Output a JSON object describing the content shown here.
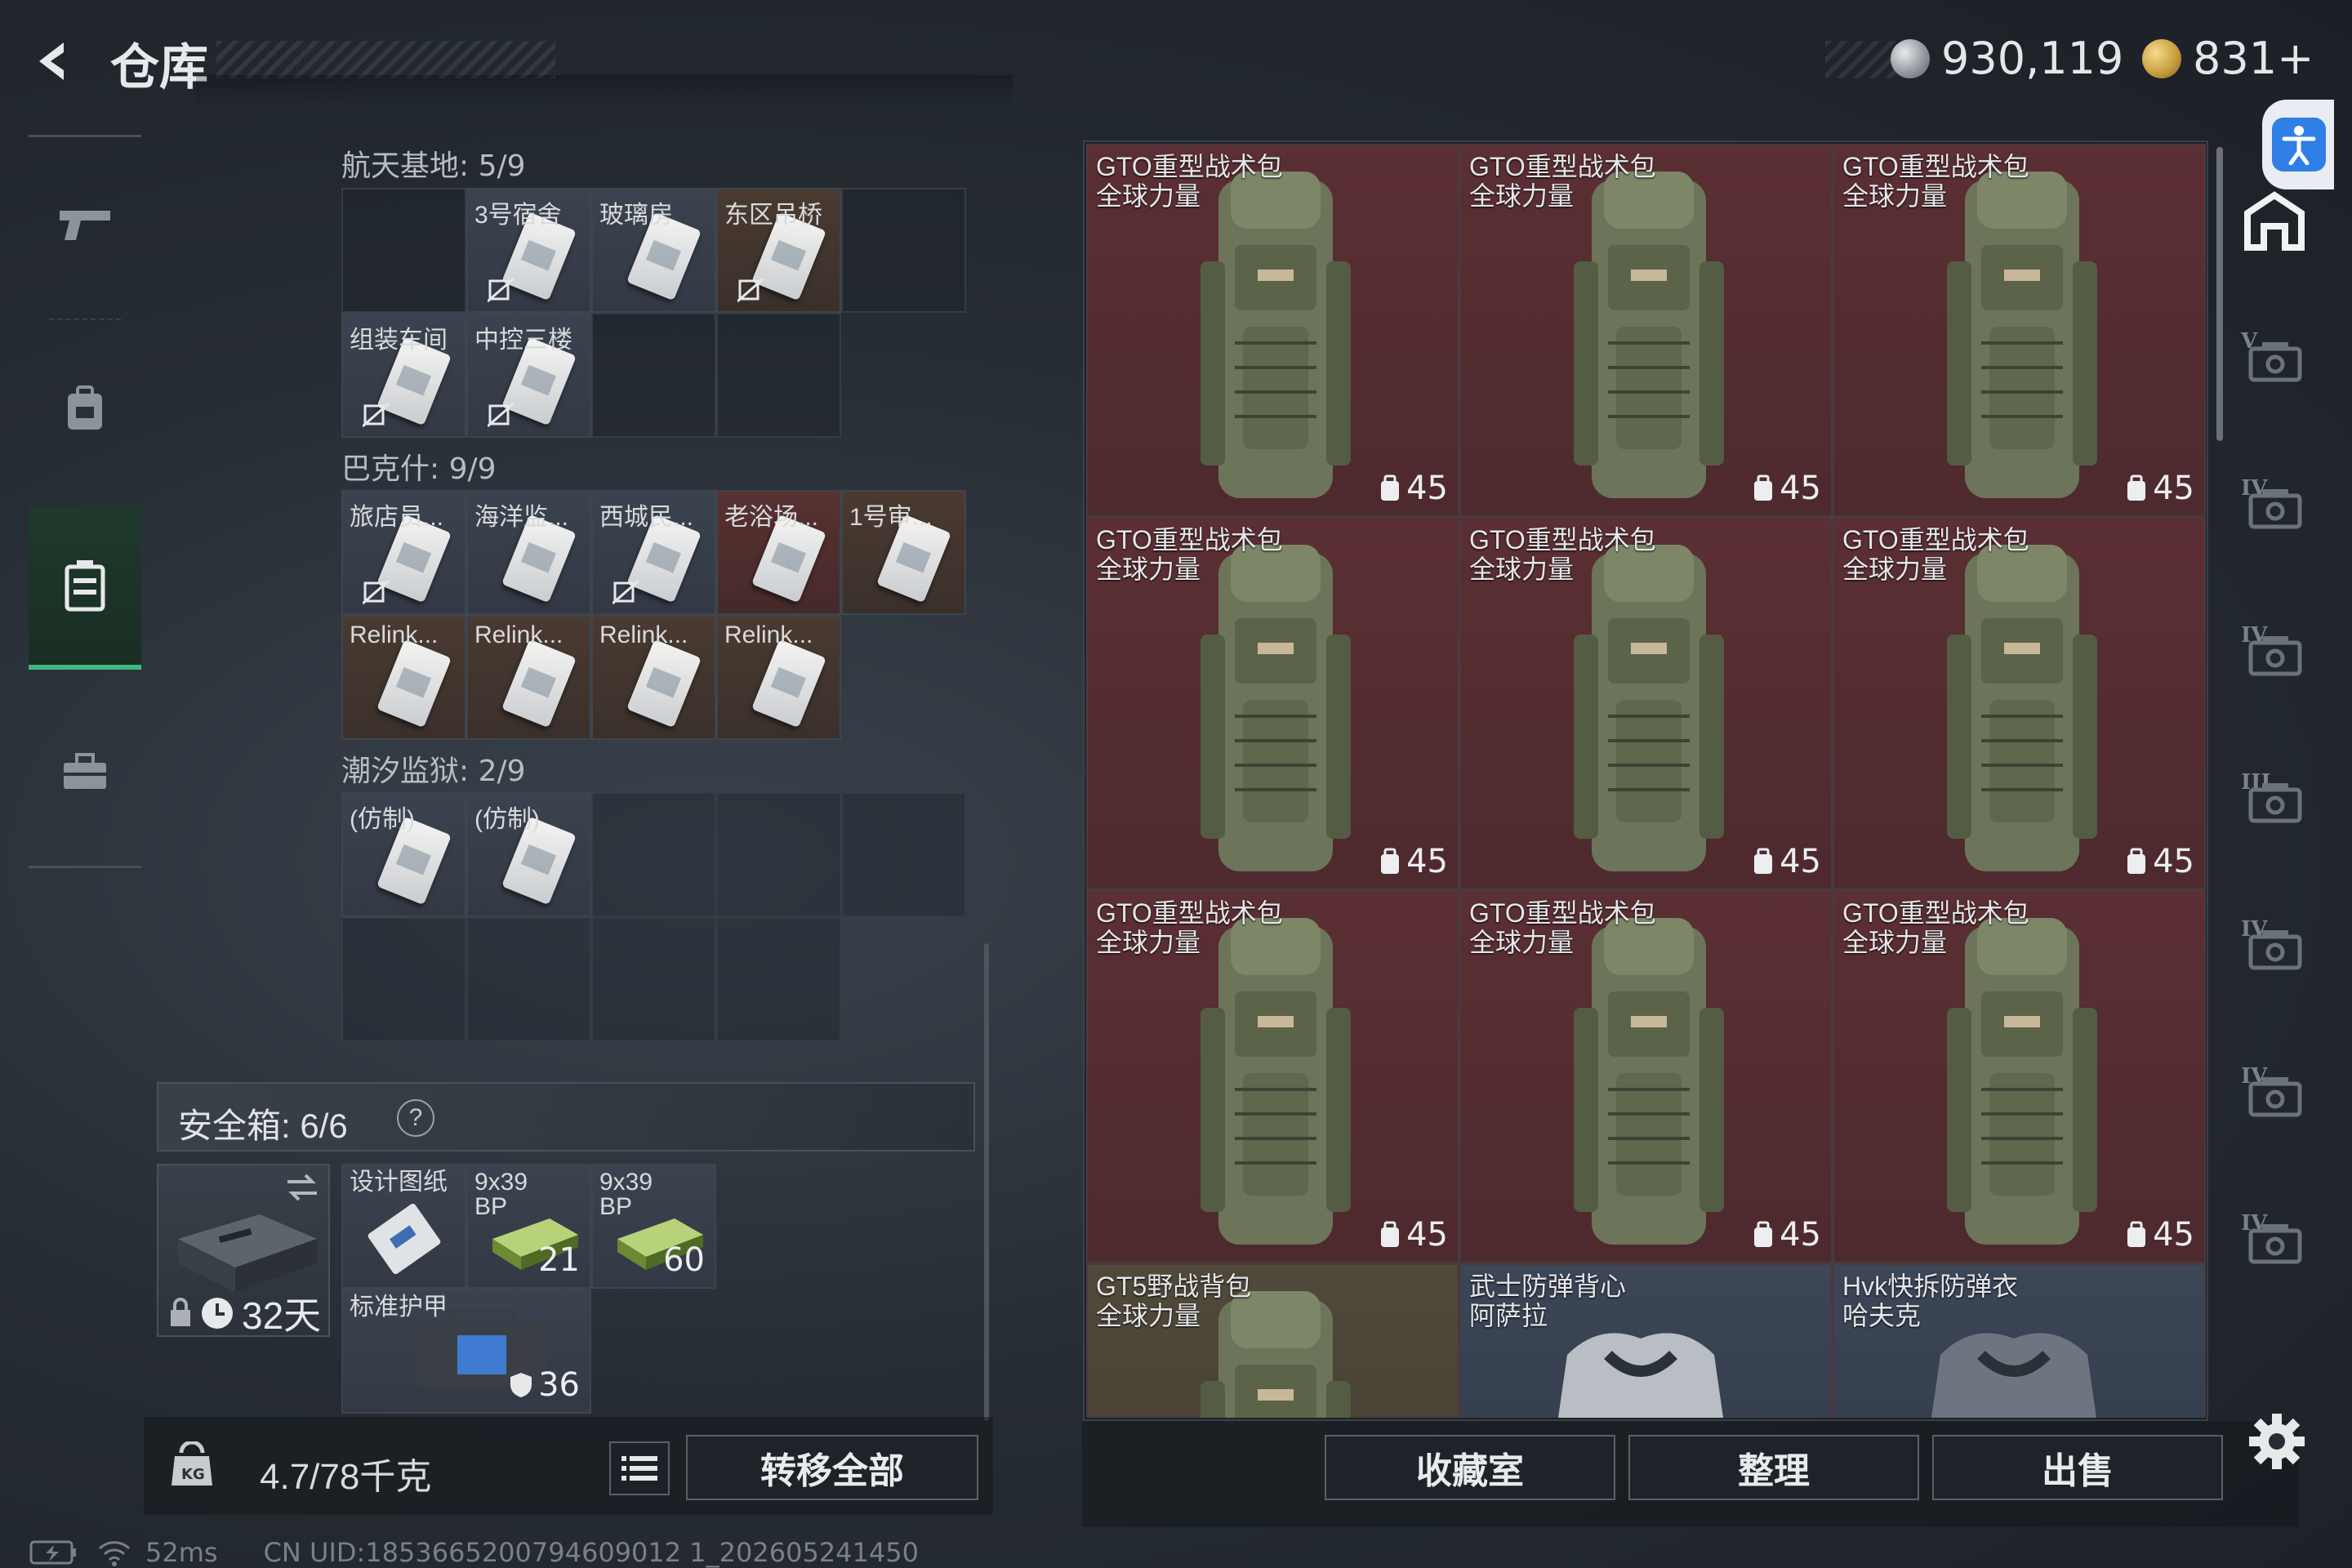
{
  "header": {
    "title": "仓库",
    "currency_silver": "930,119",
    "currency_gold": "831+"
  },
  "groups": [
    {
      "title": "航天基地: 5/9",
      "items": [
        {
          "name": "",
          "style": "empty"
        },
        {
          "name": "3号宿舍",
          "style": "gray",
          "card": true,
          "lock": true
        },
        {
          "name": "玻璃房",
          "style": "gray",
          "card": true
        },
        {
          "name": "东区吊桥",
          "style": "brown",
          "card": true,
          "lock": true
        },
        {
          "name": "",
          "style": "empty"
        },
        {
          "name": "组装车间",
          "style": "gray",
          "card": true,
          "lock": true
        },
        {
          "name": "中控三楼",
          "style": "gray",
          "card": true,
          "lock": true
        },
        {
          "name": "",
          "style": "empty"
        },
        {
          "name": "",
          "style": "empty"
        }
      ]
    },
    {
      "title": "巴克什: 9/9",
      "items": [
        {
          "name": "旅店员...",
          "style": "gray",
          "card": true,
          "lock": true
        },
        {
          "name": "海洋监...",
          "style": "gray",
          "card": true
        },
        {
          "name": "西城民...",
          "style": "gray",
          "card": true,
          "lock": true
        },
        {
          "name": "老浴场...",
          "style": "red",
          "card": true
        },
        {
          "name": "1号审...",
          "style": "brown",
          "card": true
        },
        {
          "name": "Relink...",
          "style": "brown",
          "card": true
        },
        {
          "name": "Relink...",
          "style": "brown",
          "card": true
        },
        {
          "name": "Relink...",
          "style": "brown",
          "card": true
        },
        {
          "name": "Relink...",
          "style": "brown",
          "card": true
        }
      ]
    },
    {
      "title": "潮汐监狱: 2/9",
      "items": [
        {
          "name": "(仿制)",
          "style": "gray",
          "card": true
        },
        {
          "name": "(仿制)",
          "style": "gray",
          "card": true
        },
        {
          "name": "",
          "style": "empty"
        },
        {
          "name": "",
          "style": "empty"
        },
        {
          "name": "",
          "style": "empty"
        },
        {
          "name": "",
          "style": "empty"
        },
        {
          "name": "",
          "style": "empty"
        },
        {
          "name": "",
          "style": "empty"
        },
        {
          "name": "",
          "style": "empty"
        }
      ]
    }
  ],
  "safebox": {
    "label": "安全箱:  6/6",
    "help": "?",
    "days": "32天",
    "items": [
      {
        "name": "设计图纸",
        "count": "",
        "kind": "blueprint"
      },
      {
        "name": "9x39\nBP",
        "count": "21",
        "kind": "ammo"
      },
      {
        "name": "9x39\nBP",
        "count": "60",
        "kind": "ammo"
      },
      {
        "name": "标准护甲",
        "count": "36",
        "kind": "armor"
      }
    ]
  },
  "footer_left": {
    "weight": "4.7/78千克",
    "transfer_label": "转移全部"
  },
  "right_items": [
    {
      "name": "GTO重型战术包\n全球力量",
      "count": "45",
      "style": "red"
    },
    {
      "name": "GTO重型战术包\n全球力量",
      "count": "45",
      "style": "red"
    },
    {
      "name": "GTO重型战术包\n全球力量",
      "count": "45",
      "style": "red"
    },
    {
      "name": "GTO重型战术包\n全球力量",
      "count": "45",
      "style": "red"
    },
    {
      "name": "GTO重型战术包\n全球力量",
      "count": "45",
      "style": "red"
    },
    {
      "name": "GTO重型战术包\n全球力量",
      "count": "45",
      "style": "red"
    },
    {
      "name": "GTO重型战术包\n全球力量",
      "count": "45",
      "style": "red"
    },
    {
      "name": "GTO重型战术包\n全球力量",
      "count": "45",
      "style": "red"
    },
    {
      "name": "GTO重型战术包\n全球力量",
      "count": "45",
      "style": "red"
    },
    {
      "name": "GT5野战背包\n全球力量",
      "count": "",
      "style": "olive"
    },
    {
      "name": "武士防弹背心\n阿萨拉",
      "count": "",
      "style": "blue"
    },
    {
      "name": "Hvk快拆防弹衣\n哈夫克",
      "count": "",
      "style": "blue"
    }
  ],
  "footer_right": {
    "collection": "收藏室",
    "organize": "整理",
    "sell": "出售"
  },
  "side_tier_labels": [
    "V",
    "IV",
    "IV",
    "III",
    "IV",
    "IV",
    "IV"
  ],
  "status_bar": {
    "ping": "52ms",
    "uid": "CN UID:1853665200794609012 1_202605241450"
  },
  "icons": [
    "back-arrow-icon",
    "silver-coin-icon",
    "gold-coin-icon",
    "pistol-icon",
    "backpack-icon",
    "safe-case-icon",
    "toolbox-icon",
    "accessibility-icon",
    "home-tab-icon",
    "weight-icon",
    "list-icon",
    "settings-gear-icon",
    "battery-icon",
    "wifi-icon",
    "lock-icon",
    "clock-icon",
    "shield-icon",
    "weight-lock-icon"
  ],
  "colors": {
    "accent_green": "#3fb87e",
    "item_red": "#5b2f33",
    "accessibility_blue": "#2f7fe6"
  }
}
